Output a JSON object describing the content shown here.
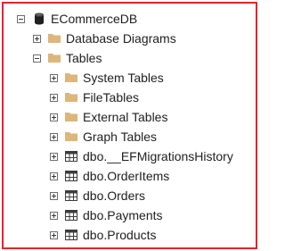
{
  "tree": {
    "database": {
      "label": "ECommerceDB",
      "icon": "database-icon"
    },
    "database_diagrams": {
      "label": "Database Diagrams",
      "icon": "folder-icon"
    },
    "tables": {
      "label": "Tables",
      "icon": "folder-icon"
    },
    "system_tables": {
      "label": "System Tables",
      "icon": "folder-icon"
    },
    "file_tables": {
      "label": "FileTables",
      "icon": "folder-icon"
    },
    "external_tables": {
      "label": "External Tables",
      "icon": "folder-icon"
    },
    "graph_tables": {
      "label": "Graph Tables",
      "icon": "folder-icon"
    },
    "table_items": [
      {
        "label": "dbo.__EFMigrationsHistory",
        "icon": "table-icon"
      },
      {
        "label": "dbo.OrderItems",
        "icon": "table-icon"
      },
      {
        "label": "dbo.Orders",
        "icon": "table-icon"
      },
      {
        "label": "dbo.Payments",
        "icon": "table-icon"
      },
      {
        "label": "dbo.Products",
        "icon": "table-icon"
      }
    ]
  },
  "colors": {
    "highlight_border": "#e5222c",
    "folder": "#dcb67a",
    "text": "#1e1e1e"
  }
}
